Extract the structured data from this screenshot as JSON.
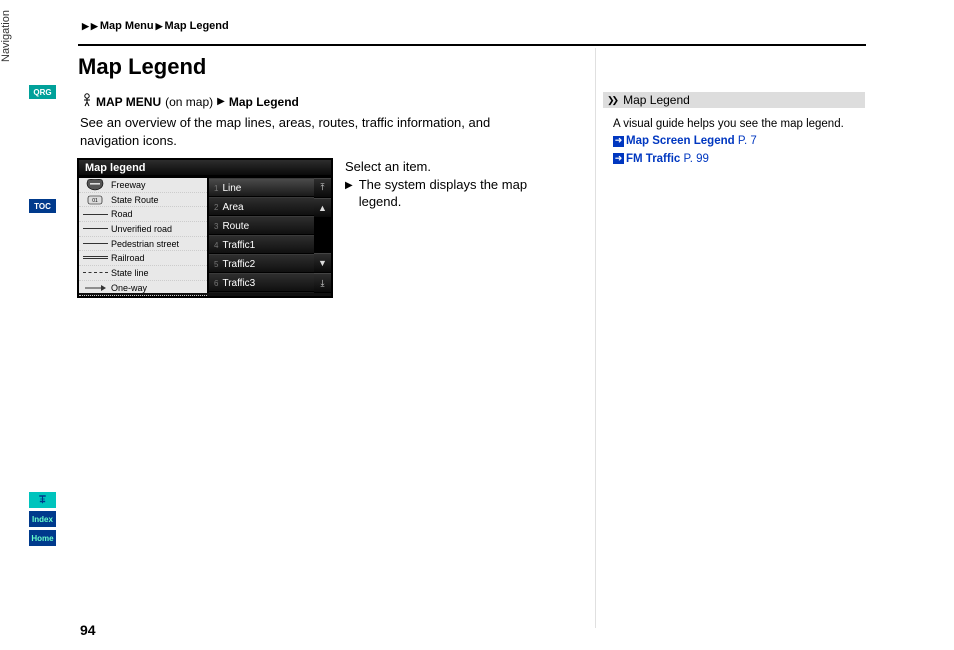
{
  "breadcrumb": {
    "part1": "Map Menu",
    "part2": "Map Legend"
  },
  "title": "Map Legend",
  "navpath": {
    "menu": "MAP MENU",
    "context": "(on map)",
    "target": "Map Legend"
  },
  "intro": "See an overview of the map lines, areas, routes, traffic information, and navigation icons.",
  "instructions": {
    "line1": "Select an item.",
    "line2": "The system displays the map legend."
  },
  "screenshot": {
    "title": "Map legend",
    "leftItems": [
      {
        "kind": "badge-interstate",
        "label": "Freeway"
      },
      {
        "kind": "badge-stateroute",
        "label": "State Route"
      },
      {
        "kind": "line-solid",
        "label": "Road"
      },
      {
        "kind": "line-solid",
        "label": "Unverified road"
      },
      {
        "kind": "line-solid",
        "label": "Pedestrian street"
      },
      {
        "kind": "line-rail",
        "label": "Railroad"
      },
      {
        "kind": "line-dash",
        "label": "State line"
      },
      {
        "kind": "line-arrow",
        "label": "One-way"
      }
    ],
    "rightItems": [
      {
        "num": "1",
        "label": "Line"
      },
      {
        "num": "2",
        "label": "Area"
      },
      {
        "num": "3",
        "label": "Route"
      },
      {
        "num": "4",
        "label": "Traffic1"
      },
      {
        "num": "5",
        "label": "Traffic2"
      },
      {
        "num": "6",
        "label": "Traffic3"
      }
    ]
  },
  "sidepanel": {
    "heading": "Map Legend",
    "body": "A visual guide helps you see the map legend.",
    "links": [
      {
        "label": "Map Screen Legend",
        "page": "P. 7"
      },
      {
        "label": "FM Traffic",
        "page": "P. 99"
      }
    ]
  },
  "rail": {
    "qrg": "QRG",
    "toc": "TOC",
    "section": "Navigation",
    "voice": "ꔊ",
    "index": "Index",
    "home": "Home"
  },
  "pagenum": "94"
}
